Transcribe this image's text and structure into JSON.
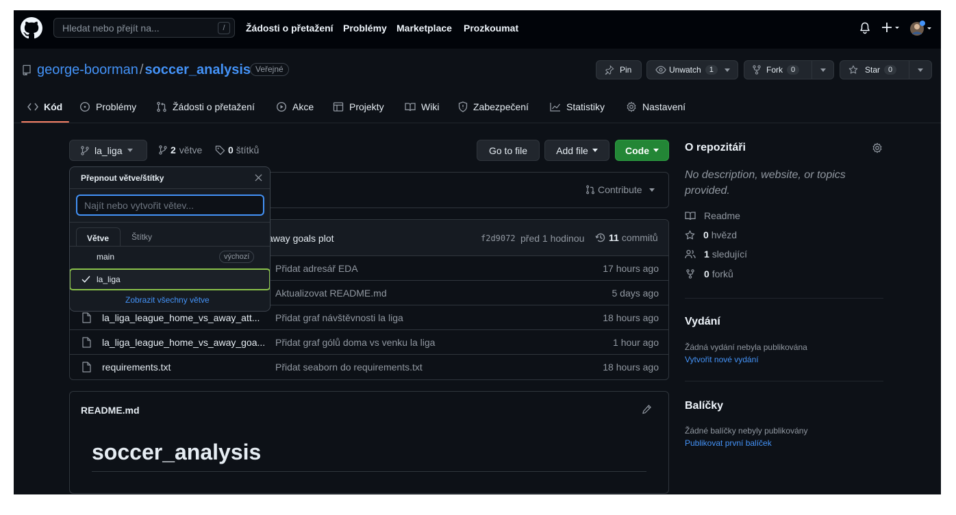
{
  "header": {
    "search_placeholder": "Hledat nebo přejít na...",
    "search_shortcut": "/",
    "nav": [
      "Žádosti o přetažení",
      "Problémy",
      "Marketplace",
      "Prozkoumat"
    ]
  },
  "repo": {
    "owner": "george-boorman",
    "separator": "/",
    "name": "soccer_analysis",
    "visibility": "Veřejné",
    "pin_label": "Pin",
    "unwatch_label": "Unwatch",
    "unwatch_count": "1",
    "fork_label": "Fork",
    "fork_count": "0",
    "star_label": "Star",
    "star_count": "0"
  },
  "tabs": [
    "Kód",
    "Problémy",
    "Žádosti o přetažení",
    "Akce",
    "Projekty",
    "Wiki",
    "Zabezpečení",
    "Statistiky",
    "Nastavení"
  ],
  "toolbar": {
    "branch": "la_liga",
    "branches_count": "2",
    "branches_label": "větve",
    "tags_count": "0",
    "tags_label": "štítků",
    "go_to_file": "Go to file",
    "add_file": "Add file",
    "code": "Code"
  },
  "contribute_label": "Contribute",
  "commit": {
    "message_fragment": "away goals plot",
    "hash": "f2d9072",
    "time": "před 1 hodinou",
    "count": "11",
    "count_label": "commitů"
  },
  "files": [
    {
      "name": "",
      "message": "Přidat adresář EDA",
      "time": "17 hours ago"
    },
    {
      "name": "",
      "message": "Aktualizovat README.md",
      "time": "5 days ago"
    },
    {
      "name": "la_liga_league_home_vs_away_att...",
      "message": "Přidat graf návštěvnosti la liga",
      "time": "18 hours ago"
    },
    {
      "name": "la_liga_league_home_vs_away_goa...",
      "message": "Přidat graf gólů doma vs venku la liga",
      "time": "1 hour ago"
    },
    {
      "name": "requirements.txt",
      "message": "Přidat seaborn do requirements.txt",
      "time": "18 hours ago"
    }
  ],
  "dropdown": {
    "title": "Přepnout větve/štítky",
    "input_placeholder": "Najít nebo vytvořit větev...",
    "tab_branches": "Větve",
    "tab_tags": "Štítky",
    "branches": [
      {
        "name": "main",
        "badge": "výchozí"
      },
      {
        "name": "la_liga",
        "badge": ""
      }
    ],
    "view_all": "Zobrazit všechny větve"
  },
  "readme": {
    "filename": "README.md",
    "heading": "soccer_analysis"
  },
  "sidebar": {
    "about_title": "O repozitáři",
    "description": "No description, website, or topics provided.",
    "readme": "Readme",
    "stars_count": "0",
    "stars_label": "hvězd",
    "watchers_count": "1",
    "watchers_label": "sledující",
    "forks_count": "0",
    "forks_label": "forků",
    "releases_title": "Vydání",
    "releases_text": "Žádná vydání nebyla publikována",
    "releases_link": "Vytvořit nové vydání",
    "packages_title": "Balíčky",
    "packages_text": "Žádné balíčky nebyly publikovány",
    "packages_link": "Publikovat první balíček"
  },
  "colors": {
    "background": "#0d1117",
    "header": "#010409",
    "link": "#4493f8",
    "green_button": "#238636",
    "highlight": "#8bc34a",
    "tab_underline": "#f78166"
  }
}
